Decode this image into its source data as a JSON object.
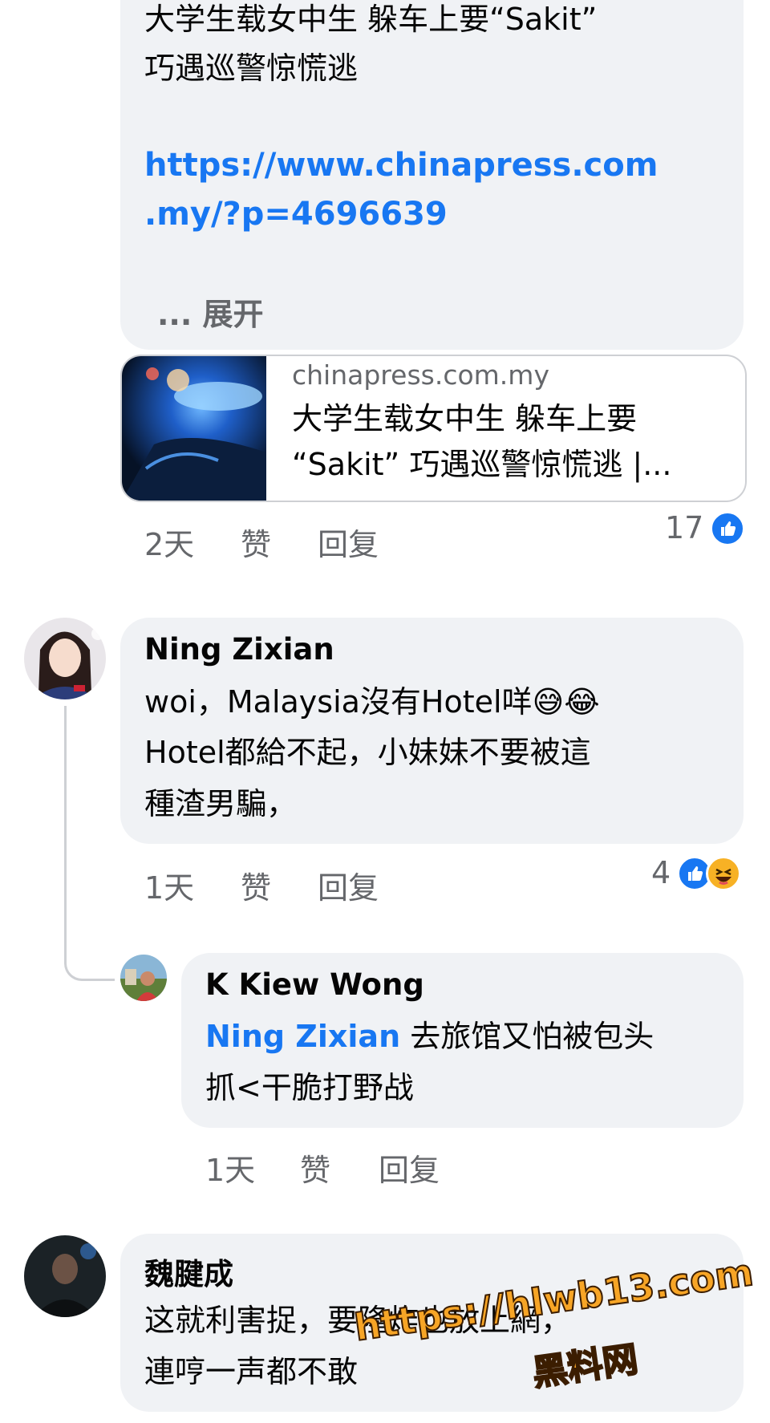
{
  "comment_1": {
    "text_line_1": "大学生载女中生 躲车上要“Sakit”",
    "text_line_2": "巧遇巡警惊慌逃",
    "link_line_1": "https://www.chinapress.com",
    "link_line_2": ".my/?p=4696639",
    "see_more": "... 展开",
    "preview": {
      "domain": "chinapress.com.my",
      "title": "大学生载女中生 躲车上要\n“Sakit” 巧遇巡警惊慌逃 |..."
    },
    "time": "2天",
    "like_label": "赞",
    "reply_label": "回复",
    "reaction_count": "17",
    "reaction_icons": [
      "like-icon"
    ]
  },
  "comment_2": {
    "author": "Ning Zixian",
    "text_line_1": "woi，Malaysia沒有Hotel咩",
    "text_line_2": "Hotel都給不起，小妹妹不要被這",
    "text_line_3": "種渣男騙，",
    "emojis": [
      "😅",
      "😂"
    ],
    "time": "1天",
    "like_label": "赞",
    "reply_label": "回复",
    "reaction_count": "4",
    "reaction_icons": [
      "like-icon",
      "haha-icon"
    ]
  },
  "reply_1": {
    "author": "K Kiew Wong",
    "mention": "Ning Zixian",
    "text_line_1": " 去旅馆又怕被包头",
    "text_line_2": "抓<干脆打野战",
    "time": "1天",
    "like_label": "赞",
    "reply_label": "回复"
  },
  "comment_3": {
    "author": "魏腱成",
    "text_line_1": "这就利害捉，要隆炸也放上網，",
    "text_line_2": "連哼一声都不敢"
  },
  "watermark": {
    "url": "https://hlwb13.com",
    "label": "黑料网"
  },
  "colors": {
    "bubble": "#f0f2f5",
    "link": "#1877f2",
    "meta": "#65676b",
    "watermark": "#f7a526"
  }
}
